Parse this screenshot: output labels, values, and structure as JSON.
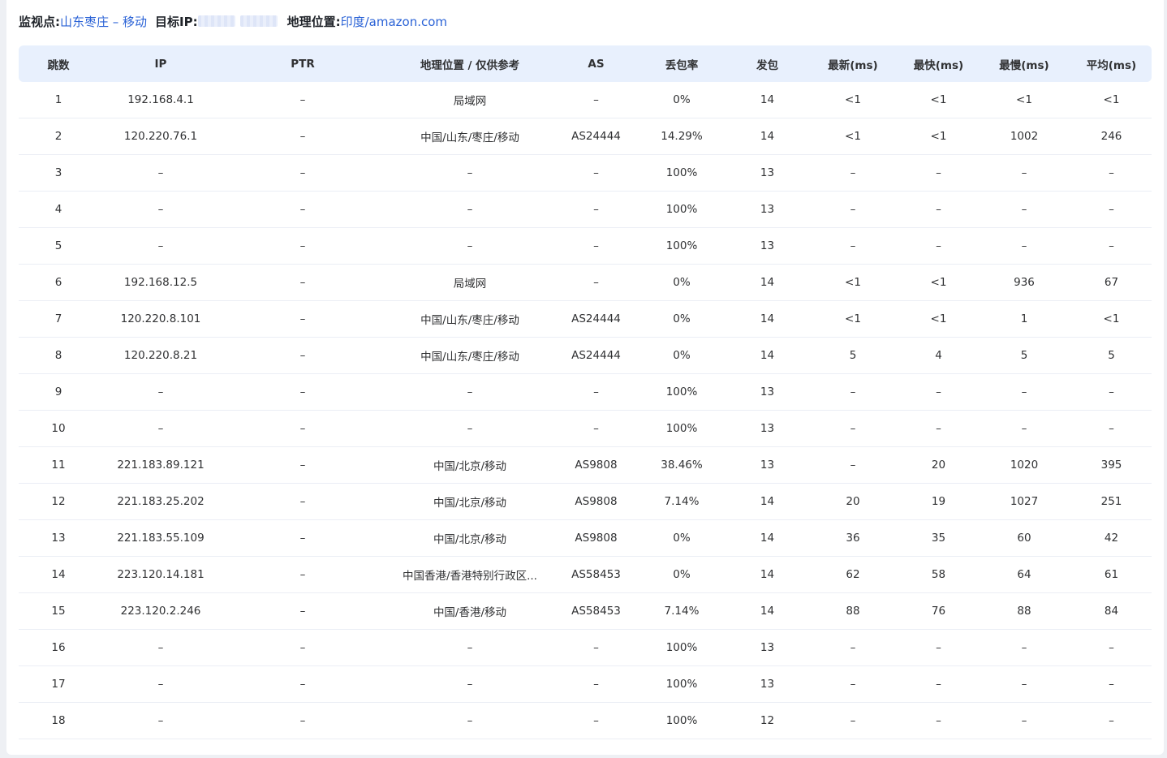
{
  "info": {
    "monitor_label": "监视点:",
    "monitor_value": "山东枣庄 – 移动",
    "target_ip_label": "目标IP:",
    "geo_label": "地理位置:",
    "geo_value": "印度/amazon.com"
  },
  "table": {
    "headers": [
      "跳数",
      "IP",
      "PTR",
      "地理位置 / 仅供参考",
      "AS",
      "丢包率",
      "发包",
      "最新(ms)",
      "最快(ms)",
      "最慢(ms)",
      "平均(ms)"
    ],
    "rows": [
      [
        "1",
        "192.168.4.1",
        "–",
        "局域网",
        "–",
        "0%",
        "14",
        "<1",
        "<1",
        "<1",
        "<1"
      ],
      [
        "2",
        "120.220.76.1",
        "–",
        "中国/山东/枣庄/移动",
        "AS24444",
        "14.29%",
        "14",
        "<1",
        "<1",
        "1002",
        "246"
      ],
      [
        "3",
        "–",
        "–",
        "–",
        "–",
        "100%",
        "13",
        "–",
        "–",
        "–",
        "–"
      ],
      [
        "4",
        "–",
        "–",
        "–",
        "–",
        "100%",
        "13",
        "–",
        "–",
        "–",
        "–"
      ],
      [
        "5",
        "–",
        "–",
        "–",
        "–",
        "100%",
        "13",
        "–",
        "–",
        "–",
        "–"
      ],
      [
        "6",
        "192.168.12.5",
        "–",
        "局域网",
        "–",
        "0%",
        "14",
        "<1",
        "<1",
        "936",
        "67"
      ],
      [
        "7",
        "120.220.8.101",
        "–",
        "中国/山东/枣庄/移动",
        "AS24444",
        "0%",
        "14",
        "<1",
        "<1",
        "1",
        "<1"
      ],
      [
        "8",
        "120.220.8.21",
        "–",
        "中国/山东/枣庄/移动",
        "AS24444",
        "0%",
        "14",
        "5",
        "4",
        "5",
        "5"
      ],
      [
        "9",
        "–",
        "–",
        "–",
        "–",
        "100%",
        "13",
        "–",
        "–",
        "–",
        "–"
      ],
      [
        "10",
        "–",
        "–",
        "–",
        "–",
        "100%",
        "13",
        "–",
        "–",
        "–",
        "–"
      ],
      [
        "11",
        "221.183.89.121",
        "–",
        "中国/北京/移动",
        "AS9808",
        "38.46%",
        "13",
        "–",
        "20",
        "1020",
        "395"
      ],
      [
        "12",
        "221.183.25.202",
        "–",
        "中国/北京/移动",
        "AS9808",
        "7.14%",
        "14",
        "20",
        "19",
        "1027",
        "251"
      ],
      [
        "13",
        "221.183.55.109",
        "–",
        "中国/北京/移动",
        "AS9808",
        "0%",
        "14",
        "36",
        "35",
        "60",
        "42"
      ],
      [
        "14",
        "223.120.14.181",
        "–",
        "中国香港/香港特别行政区...",
        "AS58453",
        "0%",
        "14",
        "62",
        "58",
        "64",
        "61"
      ],
      [
        "15",
        "223.120.2.246",
        "–",
        "中国/香港/移动",
        "AS58453",
        "7.14%",
        "14",
        "88",
        "76",
        "88",
        "84"
      ],
      [
        "16",
        "–",
        "–",
        "–",
        "–",
        "100%",
        "13",
        "–",
        "–",
        "–",
        "–"
      ],
      [
        "17",
        "–",
        "–",
        "–",
        "–",
        "100%",
        "13",
        "–",
        "–",
        "–",
        "–"
      ],
      [
        "18",
        "–",
        "–",
        "–",
        "–",
        "100%",
        "12",
        "–",
        "–",
        "–",
        "–"
      ]
    ]
  }
}
